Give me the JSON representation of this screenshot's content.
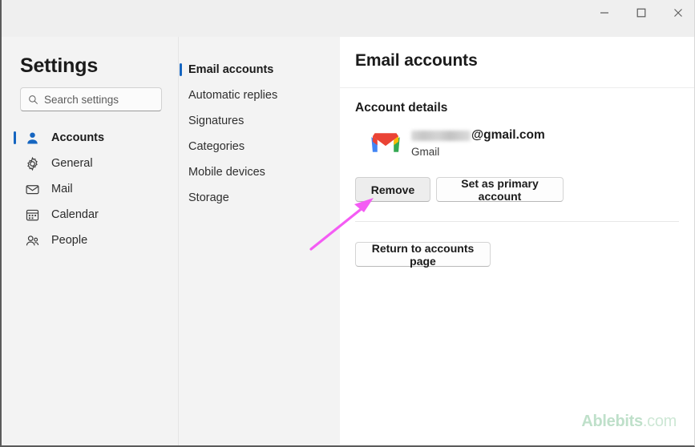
{
  "window": {
    "controls": [
      {
        "name": "minimize",
        "label": "—"
      },
      {
        "name": "maximize",
        "label": "☐"
      },
      {
        "name": "close",
        "label": "✕"
      }
    ]
  },
  "sidebar": {
    "title": "Settings",
    "search": {
      "placeholder": "Search settings",
      "value": "",
      "icon": "search-icon"
    },
    "items": [
      {
        "label": "Accounts",
        "icon": "person-icon",
        "selected": true
      },
      {
        "label": "General",
        "icon": "gear-icon",
        "selected": false
      },
      {
        "label": "Mail",
        "icon": "envelope-icon",
        "selected": false
      },
      {
        "label": "Calendar",
        "icon": "calendar-icon",
        "selected": false
      },
      {
        "label": "People",
        "icon": "people-icon",
        "selected": false
      }
    ]
  },
  "midcolumn": {
    "items": [
      {
        "label": "Email accounts",
        "selected": true
      },
      {
        "label": "Automatic replies",
        "selected": false
      },
      {
        "label": "Signatures",
        "selected": false
      },
      {
        "label": "Categories",
        "selected": false
      },
      {
        "label": "Mobile devices",
        "selected": false
      },
      {
        "label": "Storage",
        "selected": false
      }
    ]
  },
  "content": {
    "title": "Email accounts",
    "section_heading": "Account details",
    "account": {
      "icon": "gmail-icon",
      "email_redacted": true,
      "email_domain": "@gmail.com",
      "provider": "Gmail"
    },
    "buttons": {
      "remove": "Remove",
      "set_primary": "Set as primary account",
      "return": "Return to accounts page"
    }
  },
  "annotation": {
    "arrow_color": "#f45cf4",
    "points_to": "remove-button"
  },
  "watermark": {
    "brand": "Ablebits",
    "tld": ".com",
    "color": "#bfe0ca"
  }
}
